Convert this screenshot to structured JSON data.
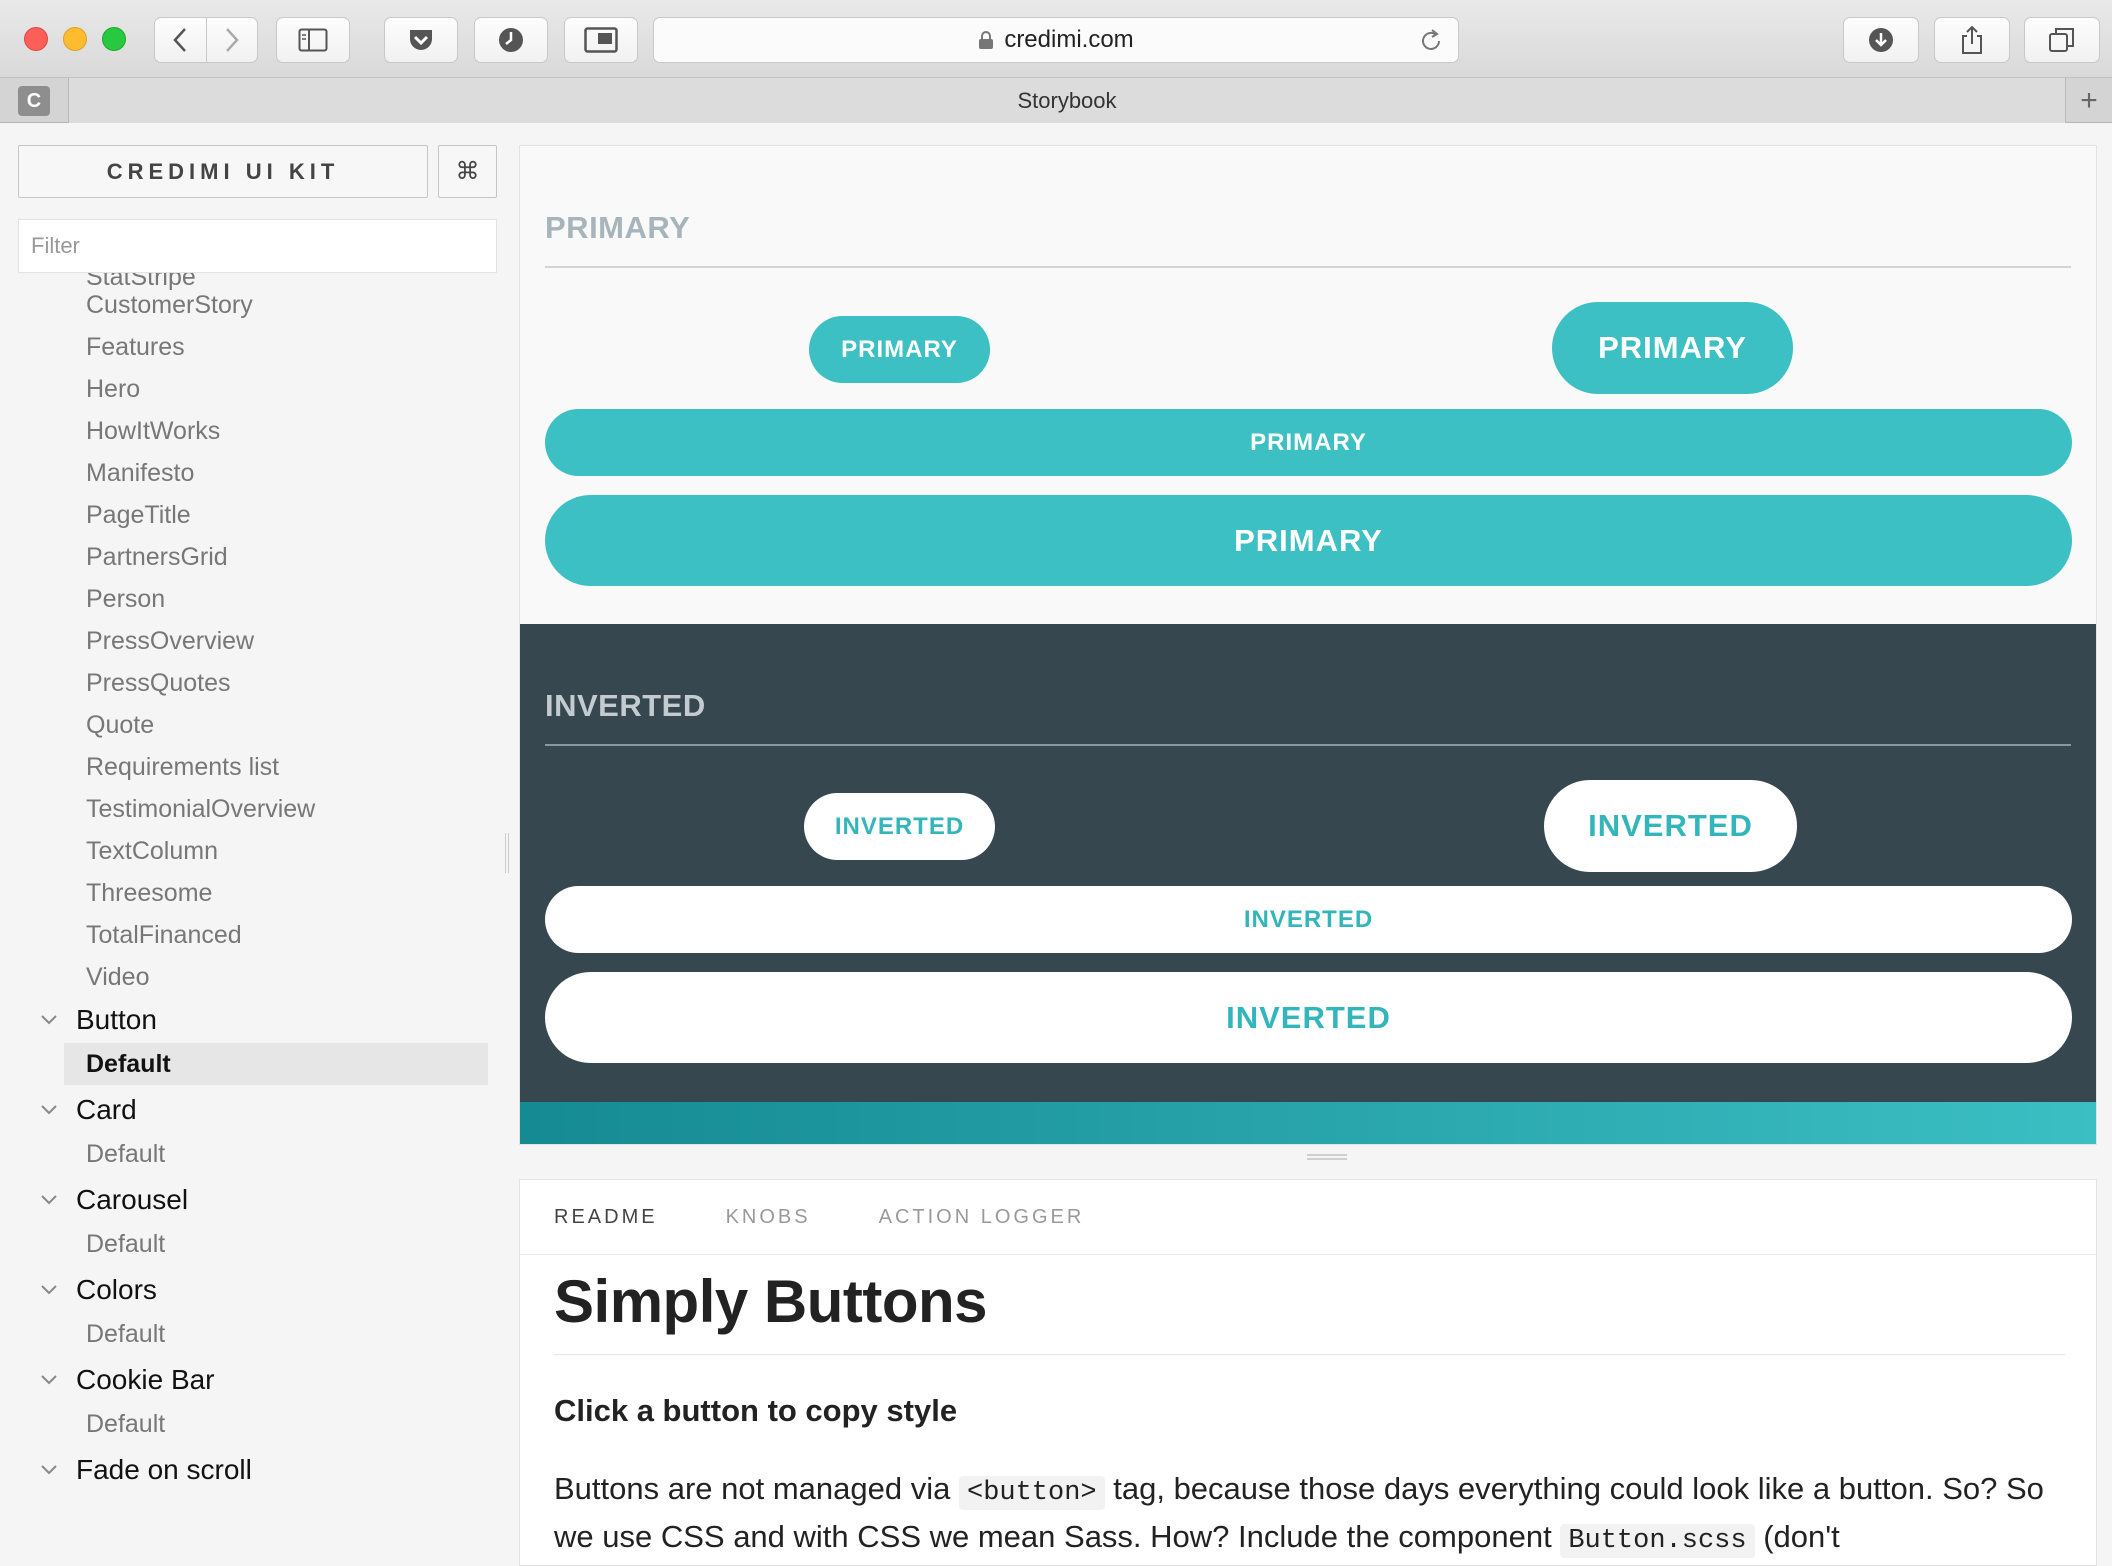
{
  "browser": {
    "url": "credimi.com",
    "tab_title": "Storybook",
    "tab_favicon_letter": "C",
    "tab_add_label": "+"
  },
  "sidebar": {
    "brand": "CREDIMI UI KIT",
    "shortcut_symbol": "⌘",
    "filter_placeholder": "Filter",
    "partial_item": "StatStripe",
    "items": [
      "CustomerStory",
      "Features",
      "Hero",
      "HowItWorks",
      "Manifesto",
      "PageTitle",
      "PartnersGrid",
      "Person",
      "PressOverview",
      "PressQuotes",
      "Quote",
      "Requirements list",
      "TestimonialOverview",
      "TextColumn",
      "Threesome",
      "TotalFinanced",
      "Video"
    ],
    "folders": [
      {
        "label": "Button",
        "child": "Default",
        "selected": true
      },
      {
        "label": "Card",
        "child": "Default"
      },
      {
        "label": "Carousel",
        "child": "Default"
      },
      {
        "label": "Colors",
        "child": "Default"
      },
      {
        "label": "Cookie Bar",
        "child": "Default"
      },
      {
        "label": "Fade on scroll"
      }
    ]
  },
  "preview": {
    "primary": {
      "title": "PRIMARY",
      "buttons": [
        "PRIMARY",
        "PRIMARY",
        "PRIMARY",
        "PRIMARY"
      ],
      "color": "#3cc0c4"
    },
    "inverted": {
      "title": "INVERTED",
      "buttons": [
        "INVERTED",
        "INVERTED",
        "INVERTED",
        "INVERTED"
      ],
      "background": "#36474f"
    }
  },
  "addons": {
    "tabs": [
      "README",
      "KNOBS",
      "ACTION LOGGER"
    ],
    "active_tab": "README",
    "readme": {
      "title": "Simply Buttons",
      "subtitle": "Click a button to copy style",
      "para_1": "Buttons are not managed via",
      "code_1": "<button>",
      "para_2": "tag, because those days everything could look like a button.",
      "para_3": "So? So we use CSS and with CSS we mean Sass. How? Include the component",
      "code_2": "Button.scss",
      "para_4": "(don't"
    }
  }
}
